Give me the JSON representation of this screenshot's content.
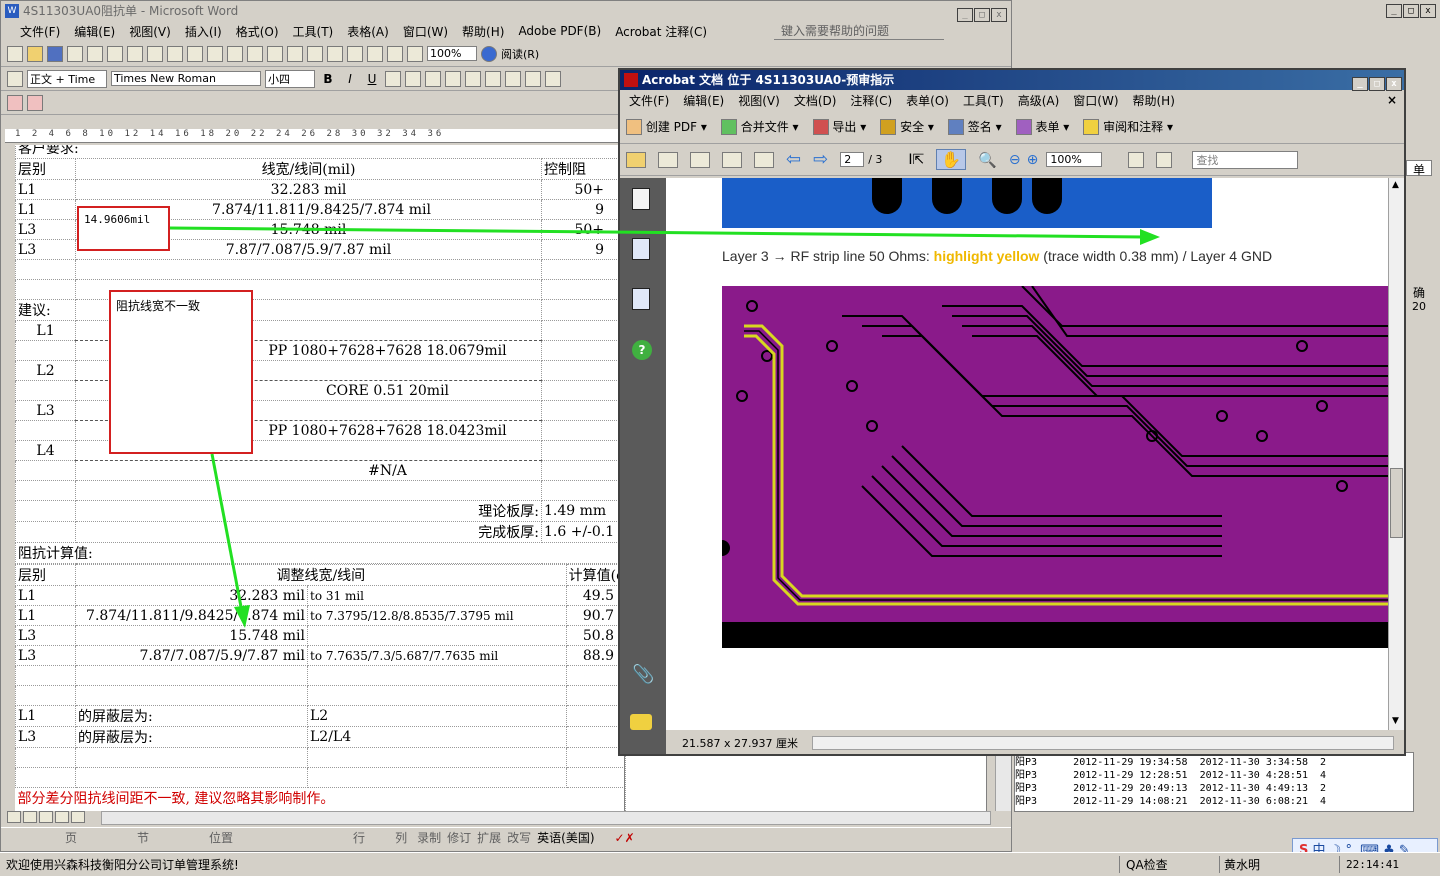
{
  "word": {
    "title": "4S11303UA0阻抗单 - Microsoft Word",
    "menu": [
      "文件(F)",
      "编辑(E)",
      "视图(V)",
      "插入(I)",
      "格式(O)",
      "工具(T)",
      "表格(A)",
      "窗口(W)",
      "帮助(H)",
      "Adobe PDF(B)",
      "Acrobat 注释(C)"
    ],
    "help_placeholder": "键入需要帮助的问题",
    "style": "正文 + Time",
    "font": "Times New Roman",
    "size": "小四",
    "zoom": "100%",
    "read_btn": "阅读(R)",
    "ruler": "1 2 4 6 8 10 12 14 16 18 20 22 24 26 28 30 32 34 36",
    "status": [
      "页",
      "节",
      "位置",
      "行",
      "列",
      "录制",
      "修订",
      "扩展",
      "改写",
      "英语(美国)"
    ],
    "head_partial": "客户要求:",
    "t1_headers": [
      "层别",
      "线宽/线间(mil)",
      "控制阻"
    ],
    "t1_rows": [
      [
        "L1",
        "32.283 mil",
        "50+"
      ],
      [
        "L1",
        "7.874/11.811/9.8425/7.874 mil",
        "9"
      ],
      [
        "L3",
        "15.748 mil",
        "50+"
      ],
      [
        "L3",
        "7.87/7.087/5.9/7.87 mil",
        "9"
      ]
    ],
    "suggest_label": "建议:",
    "stack": [
      [
        "L1",
        ""
      ],
      [
        "",
        "PP   1080+7628+7628   18.0679mil"
      ],
      [
        "L2",
        ""
      ],
      [
        "",
        "CORE   0.51   20mil"
      ],
      [
        "L3",
        ""
      ],
      [
        "",
        "PP   1080+7628+7628   18.0423mil"
      ],
      [
        "L4",
        ""
      ],
      [
        "",
        "#N/A"
      ]
    ],
    "theory_label": "理论板厚:",
    "theory_val": "1.49 mm",
    "finish_label": "完成板厚:",
    "finish_val": "1.6 +/-0.1",
    "calc_label": "阻抗计算值:",
    "t2_headers": [
      "层别",
      "调整线宽/线间",
      "计算值(ohm"
    ],
    "t2_rows": [
      [
        "L1",
        "32.283 mil",
        "to  31 mil",
        "49.5"
      ],
      [
        "L1",
        "7.874/11.811/9.8425/7.874 mil",
        "to  7.3795/12.8/8.8535/7.3795 mil",
        "90.7"
      ],
      [
        "L3",
        "15.748 mil",
        "",
        "50.8"
      ],
      [
        "L3",
        "7.87/7.087/5.9/7.87 mil",
        "to  7.7635/7.3/5.687/7.7635 mil",
        "88.9"
      ]
    ],
    "shield": [
      [
        "L1",
        "的屏蔽层为:",
        "L2"
      ],
      [
        "L3",
        "的屏蔽层为:",
        "L2/L4"
      ]
    ],
    "note": "部分差分阻抗线间距不一致, 建议忽略其影响制作。",
    "callout1": "14.9606mil",
    "callout2": "阻抗线宽不一致"
  },
  "acrobat": {
    "title": "Acrobat 文档 位于 4S11303UA0-预审指示",
    "menu": [
      "文件(F)",
      "编辑(E)",
      "视图(V)",
      "文档(D)",
      "注释(C)",
      "表单(O)",
      "工具(T)",
      "高级(A)",
      "窗口(W)",
      "帮助(H)"
    ],
    "tools": [
      "创建 PDF",
      "合并文件",
      "导出",
      "安全",
      "签名",
      "表单",
      "审阅和注释"
    ],
    "page_current": "2",
    "page_total": "/ 3",
    "zoom": "100%",
    "search_placeholder": "查找",
    "caption_pre": "Layer 3 → RF strip line 50 Ohms: ",
    "caption_hl": "highlight yellow",
    "caption_post": " (trace width 0.38 mm) / Layer 4 GND",
    "page_size": "21.587 x 27.937 厘米",
    "colors": {
      "pcb_purple": "#8a1a8a",
      "pcb_blue": "#1a5ec8",
      "trace_yellow": "#d8d820",
      "highlight": "#f0b800"
    }
  },
  "background_app": {
    "side_labels": [
      "单",
      "确",
      "20"
    ],
    "rows": [
      [
        "阳P3",
        "2012-11-29 19:34:58",
        "2012-11-30 3:34:58",
        "2"
      ],
      [
        "阳P3",
        "2012-11-29 12:28:51",
        "2012-11-30 4:28:51",
        "4"
      ],
      [
        "阳P3",
        "2012-11-29 20:49:13",
        "2012-11-30 4:49:13",
        "2"
      ],
      [
        "阳P3",
        "2012-11-29 14:08:21",
        "2012-11-30 6:08:21",
        "4"
      ]
    ],
    "status_left": "欢迎使用兴森科技衡阳分公司订单管理系统!",
    "status_qa": "QA检查",
    "status_user": "黄水明",
    "clock": "22:14:41",
    "ime": "中"
  }
}
